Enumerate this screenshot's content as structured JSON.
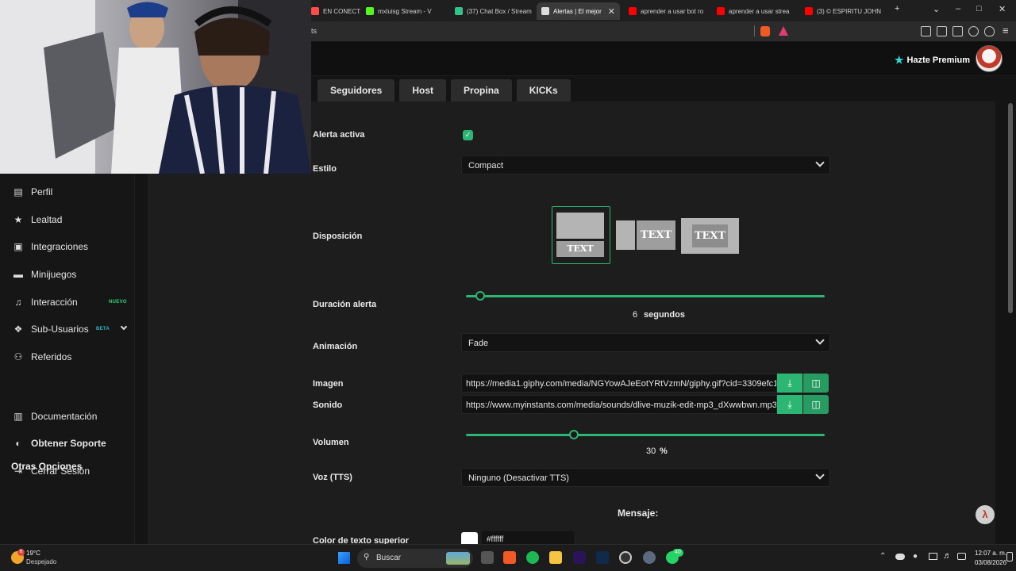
{
  "browser": {
    "tabs": [
      {
        "title": "EN CONECTA",
        "fav": "#ff4d4d",
        "active": false
      },
      {
        "title": "mxluisg Stream - V",
        "fav": "#53fc18",
        "active": false
      },
      {
        "title": "(37) Chat Box / Stream",
        "fav": "#35c28a",
        "active": false
      },
      {
        "title": "Alertas | El mejor",
        "fav": "#dcdcdc",
        "active": true
      },
      {
        "title": "aprender a usar bot ro",
        "fav": "#ff0000",
        "active": false
      },
      {
        "title": "aprender a usar strea",
        "fav": "#ff0000",
        "active": false
      },
      {
        "title": "(3) © ESPIRITU JOHN",
        "fav": "#ff0000",
        "active": false
      }
    ],
    "address_text": "ts"
  },
  "header": {
    "premium_label": "Hazte Premium"
  },
  "sidebar": {
    "items": [
      {
        "label": "Perfil",
        "icon": "id-card-icon",
        "glyph": "▤"
      },
      {
        "label": "Lealtad",
        "icon": "trophy-icon",
        "glyph": "★"
      },
      {
        "label": "Integraciones",
        "icon": "plug-icon",
        "glyph": "▣"
      },
      {
        "label": "Minijuegos",
        "icon": "gamepad-icon",
        "glyph": "▬"
      },
      {
        "label": "Interacción",
        "icon": "music-icon",
        "glyph": "♫",
        "badge": "NUEVO"
      },
      {
        "label": "Sub-Usuarios",
        "icon": "users-icon",
        "glyph": "❖",
        "badge": "BETA"
      },
      {
        "label": "Referidos",
        "icon": "user-group-icon",
        "glyph": "⚇"
      }
    ],
    "section_title": "Otras Opciones",
    "extra": [
      {
        "label": "Documentación",
        "icon": "book-icon",
        "glyph": "▥"
      },
      {
        "label": "Obtener Soporte",
        "icon": "discord-icon",
        "glyph": "◐"
      },
      {
        "label": "Cerrar Sesión",
        "icon": "logout-icon",
        "glyph": "⇥"
      }
    ]
  },
  "alert_tabs": [
    "Seguidores",
    "Host",
    "Propina",
    "KICKs"
  ],
  "form": {
    "alerta_activa_label": "Alerta activa",
    "alerta_activa": true,
    "estilo_label": "Estilo",
    "estilo_value": "Compact",
    "disposicion_label": "Disposición",
    "disposicion_text": "TEXT",
    "duracion_label": "Duración alerta",
    "duracion_value": "6",
    "duracion_unit": "segundos",
    "duracion_fraction": 0.04,
    "animacion_label": "Animación",
    "animacion_value": "Fade",
    "imagen_label": "Imagen",
    "imagen_value": "https://media1.giphy.com/media/NGYowAJeEotYRtVzmN/giphy.gif?cid=3309efc1",
    "sonido_label": "Sonido",
    "sonido_value": "https://www.myinstants.com/media/sounds/dlive-muzik-edit-mp3_dXwwbwn.mp3",
    "volumen_label": "Volumen",
    "volumen_value": "30",
    "volumen_unit": "%",
    "volumen_fraction": 0.3,
    "voz_label": "Voz (TTS)",
    "voz_value": "Ninguno (Desactivar TTS)",
    "mensaje_title": "Mensaje:",
    "color_superior_label": "Color de texto superior",
    "color_superior_value": "#ffffff"
  },
  "taskbar": {
    "weather_temp": "19°C",
    "weather_desc": "Despejado",
    "weather_badge": "6",
    "search_placeholder": "Buscar",
    "whatsapp_badge": "40",
    "time": "12:07 a. m.",
    "date": "03/08/2026"
  }
}
